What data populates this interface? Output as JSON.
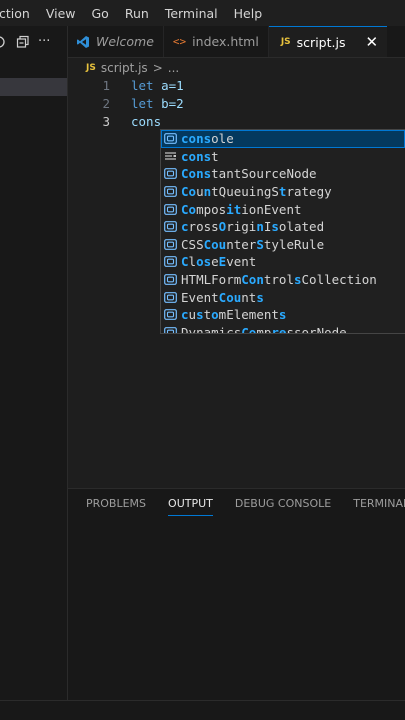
{
  "menubar": {
    "items": [
      "ction",
      "View",
      "Go",
      "Run",
      "Terminal",
      "Help"
    ]
  },
  "sidebar": {
    "toolbar_icons": [
      "refresh-icon",
      "collapse-all-icon",
      "more-actions-icon"
    ],
    "more_label": "···"
  },
  "tabs": [
    {
      "label": "Welcome",
      "icon": "vscode-icon",
      "active": false
    },
    {
      "label": "index.html",
      "icon": "html-icon",
      "icon_text": "<>",
      "active": false
    },
    {
      "label": "script.js",
      "icon": "js-icon",
      "icon_text": "JS",
      "active": true
    }
  ],
  "tab_close": "✕",
  "breadcrumb": {
    "icon_text": "JS",
    "file": "script.js",
    "separator": ">",
    "more": "..."
  },
  "editor": {
    "lines": [
      {
        "num": "1",
        "kw": "let",
        "rest": " a=1"
      },
      {
        "num": "2",
        "kw": "let",
        "rest": " b=2"
      },
      {
        "num": "3",
        "text": "cons"
      }
    ]
  },
  "suggestions": [
    {
      "label": "console",
      "kind": "variable",
      "matched": [
        0,
        1,
        2,
        3
      ]
    },
    {
      "label": "const",
      "kind": "snippet",
      "matched": [
        0,
        1,
        2,
        3
      ]
    },
    {
      "label": "ConstantSourceNode",
      "kind": "variable",
      "matched": [
        0,
        1,
        2,
        3
      ]
    },
    {
      "label": "CountQueuingStrategy",
      "kind": "variable",
      "matched": [
        0,
        1,
        3,
        13
      ]
    },
    {
      "label": "CompositionEvent",
      "kind": "variable",
      "matched": [
        0,
        1,
        6,
        7
      ]
    },
    {
      "label": "crossOriginIsolated",
      "kind": "variable",
      "matched": [
        0,
        5,
        10,
        12
      ]
    },
    {
      "label": "CSSCounterStyleRule",
      "kind": "variable",
      "matched": [
        3,
        4,
        5,
        10
      ]
    },
    {
      "label": "CloseEvent",
      "kind": "variable",
      "matched": [
        0,
        2,
        3,
        5
      ]
    },
    {
      "label": "HTMLFormControlsCollection",
      "kind": "variable",
      "matched": [
        8,
        9,
        10,
        15
      ]
    },
    {
      "label": "EventCounts",
      "kind": "variable",
      "matched": [
        5,
        6,
        7,
        10
      ]
    },
    {
      "label": "customElements",
      "kind": "variable",
      "matched": [
        0,
        2,
        4,
        13
      ]
    },
    {
      "label": "DynamicsCompressorNode",
      "kind": "variable",
      "matched": [
        8,
        9,
        12,
        13
      ]
    }
  ],
  "panel": {
    "tabs": [
      {
        "label": "PROBLEMS",
        "active": false
      },
      {
        "label": "OUTPUT",
        "active": true
      },
      {
        "label": "DEBUG CONSOLE",
        "active": false
      },
      {
        "label": "TERMINAL",
        "active": false
      }
    ]
  },
  "colors": {
    "accent": "#0078d4",
    "match_highlight": "#2aaaff",
    "keyword": "#569cd6",
    "selection": "#04395e"
  }
}
